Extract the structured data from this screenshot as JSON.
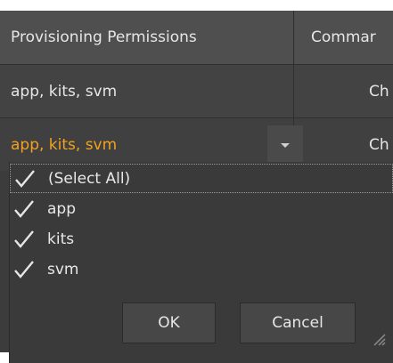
{
  "grid": {
    "headers": [
      "Provisioning Permissions",
      "Commar"
    ],
    "rows": [
      {
        "permissions": "app, kits, svm",
        "command": "Ch"
      },
      {
        "permissions": "app, kits, svm",
        "command": "Ch"
      }
    ]
  },
  "filter_popup": {
    "items": [
      {
        "label": "(Select All)",
        "checked": true
      },
      {
        "label": "app",
        "checked": true
      },
      {
        "label": "kits",
        "checked": true
      },
      {
        "label": "svm",
        "checked": true
      }
    ],
    "ok_label": "OK",
    "cancel_label": "Cancel"
  },
  "colors": {
    "background": "#3c3c3c",
    "header": "#4f4f4f",
    "editing_text": "#f2a21f",
    "text": "#e6e6e6"
  },
  "icons": {
    "dropdown": "chevron-down-icon",
    "checkbox": "checkmark-icon",
    "resize": "resize-grip-icon"
  }
}
